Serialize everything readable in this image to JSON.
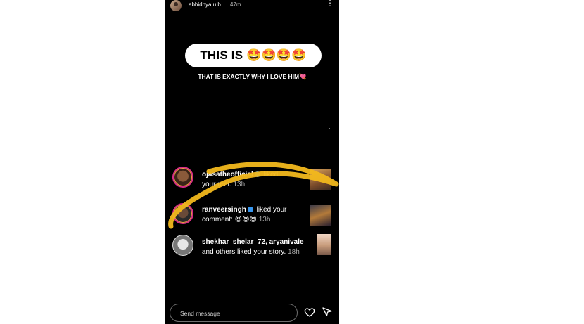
{
  "story": {
    "username": "abhidnya.u.b",
    "time": "47m",
    "more_icon": "⋮",
    "headline": "THIS IS 🤩🤩🤩🤩",
    "subtitle": "THAT IS EXACTLY WHY I LOVE HIM💘"
  },
  "notifications": [
    {
      "user": "ojasatheofficial",
      "verified": true,
      "action": "liked",
      "line2": "your reel.",
      "time": "13h"
    },
    {
      "user": "ranveersingh",
      "verified": true,
      "action": "liked your",
      "line2": "comment: 😍😍😍",
      "time": "13h"
    },
    {
      "user": "shekhar_shelar_72, aryanivale",
      "verified": false,
      "action": "",
      "line2": "and others liked your story.",
      "time": "18h"
    }
  ],
  "reply": {
    "placeholder": "Send message"
  },
  "colors": {
    "background": "#000000",
    "brush_stroke": "#F2B81C",
    "verified": "#3897F0"
  },
  "icons": [
    "more-icon",
    "heart-icon",
    "send-icon",
    "verified-icon"
  ]
}
